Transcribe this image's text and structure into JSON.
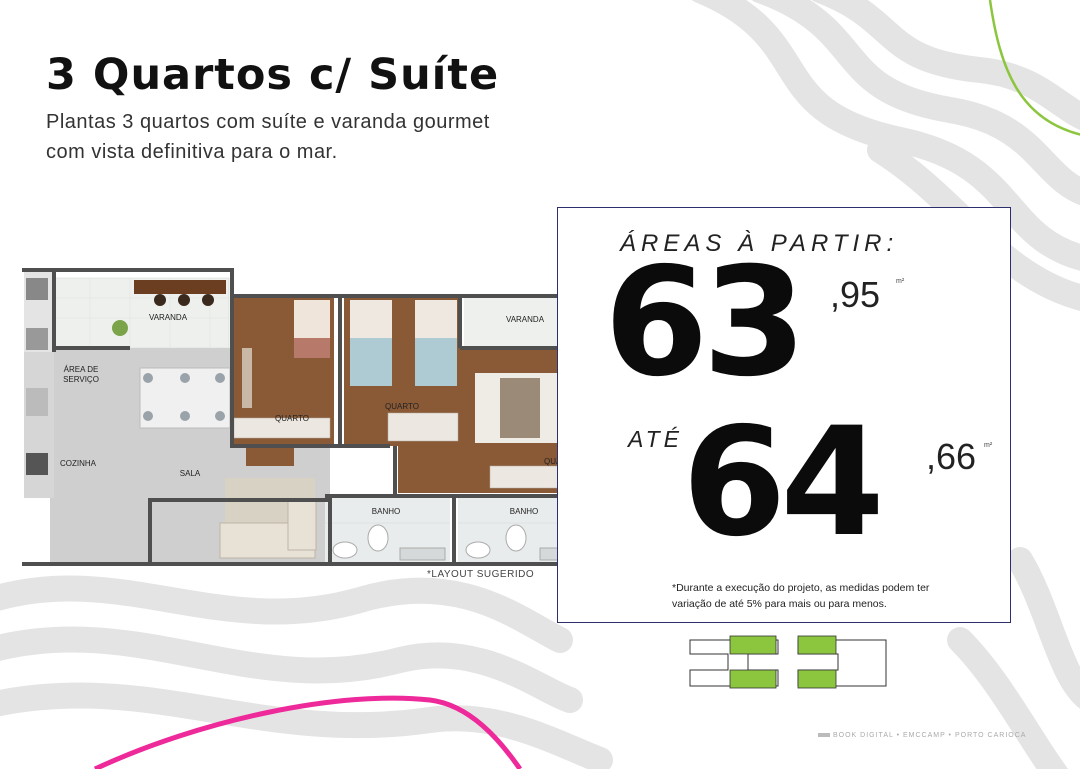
{
  "page": {
    "title": "3 Quartos c/ Suíte",
    "subtitle_lines": [
      "Plantas 3 quartos com  suíte e varanda gourmet",
      "com vista definitiva para o mar."
    ]
  },
  "floor_plan": {
    "rooms": {
      "varanda_1": "VARANDA",
      "varanda_2": "VARANDA",
      "area_servico_line1": "ÁREA DE",
      "area_servico_line2": "SERVIÇO",
      "cozinha": "COZINHA",
      "sala": "SALA",
      "quarto_1": "QUARTO",
      "quarto_2": "QUARTO",
      "quarto_3": "QUARTO",
      "banho_1": "BANHO",
      "banho_2": "BANHO"
    },
    "note": "*LAYOUT SUGERIDO"
  },
  "areas": {
    "label": "ÁREAS À PARTIR:",
    "from_whole": "63",
    "from_decimal": ",95",
    "connector": "ATÉ",
    "to_whole": "64",
    "to_decimal": ",66",
    "unit": "m²",
    "disclaimer_lines": [
      "*Durante a execução do projeto, as medidas podem ter",
      "variação de até 5% para mais ou para menos."
    ]
  },
  "colors": {
    "accent_green": "#8cc63f",
    "accent_pink": "#ee2a9b",
    "box_border": "#2b2f6b",
    "wave_gray": "#e3e3e3"
  },
  "footer": {
    "text": "BOOK DIGITAL • EMCCAMP • PORTO CARIOCA"
  }
}
